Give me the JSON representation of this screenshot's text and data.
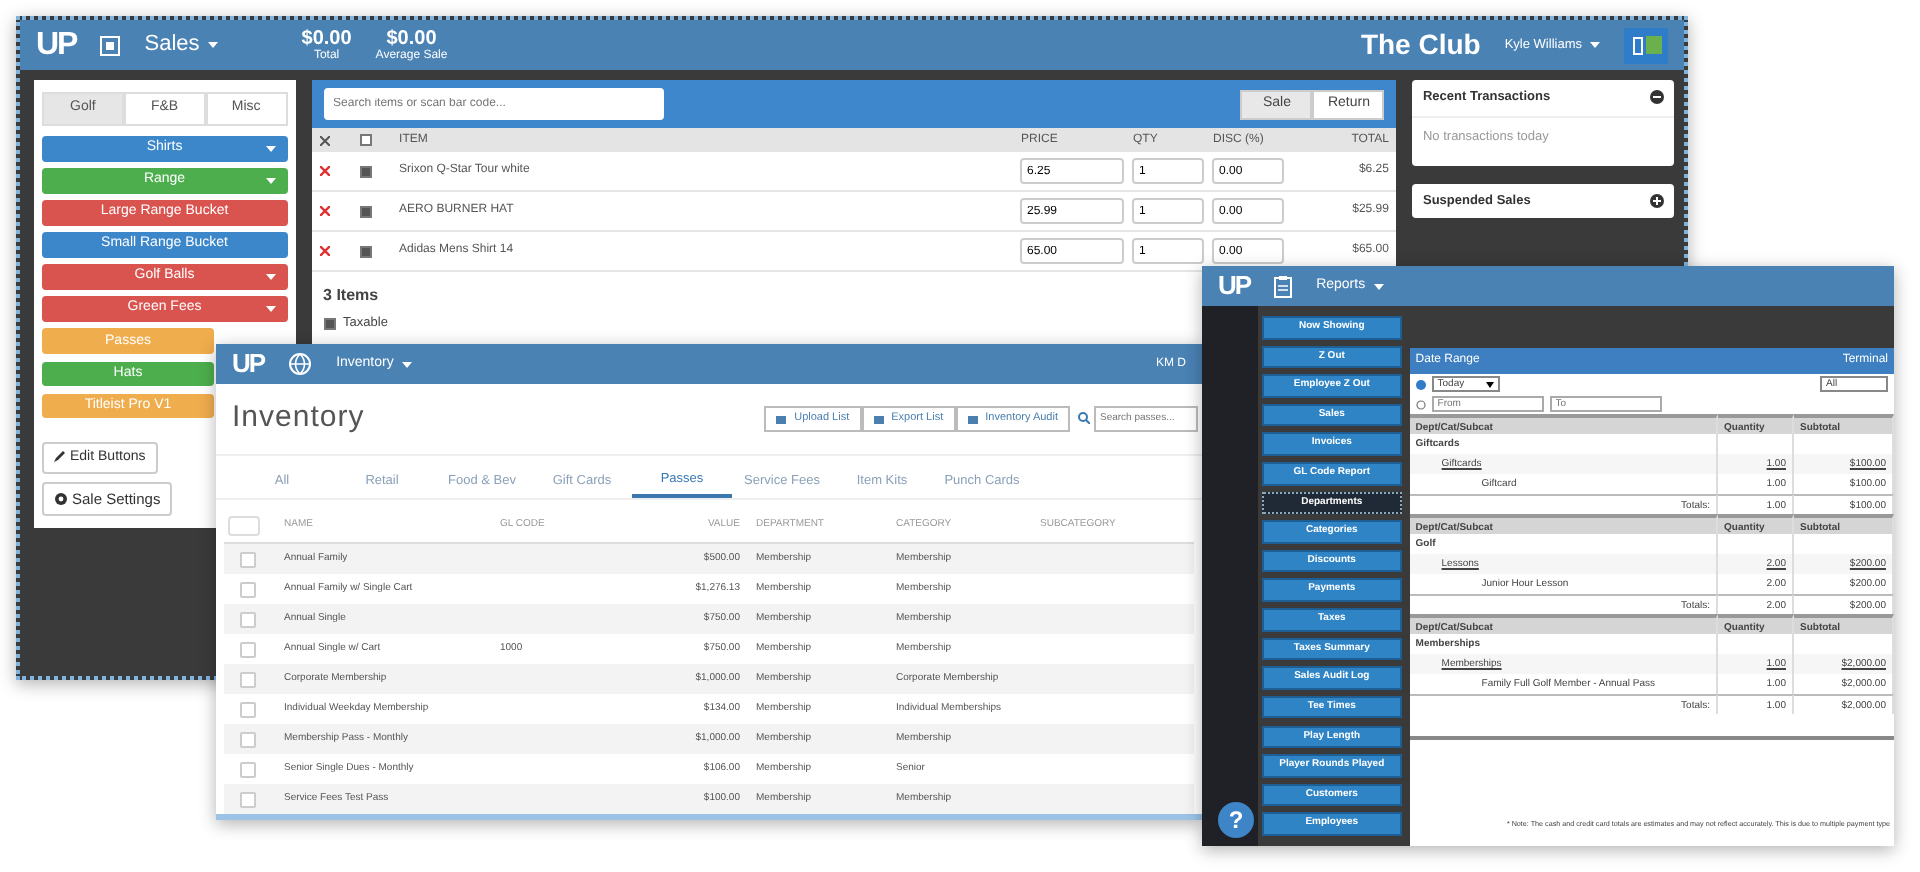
{
  "pos": {
    "logo": "UP",
    "menu": "Sales",
    "stats": [
      {
        "value": "$0.00",
        "label": "Total"
      },
      {
        "value": "$0.00",
        "label": "Average Sale"
      }
    ],
    "club": "The Club",
    "user": "Kyle Williams",
    "category_tabs": [
      {
        "label": "Golf",
        "selected": true
      },
      {
        "label": "F&B",
        "selected": false
      },
      {
        "label": "Misc",
        "selected": false
      }
    ],
    "buttons": [
      {
        "label": "Shirts",
        "color": "#3b87c9",
        "dropdown": true
      },
      {
        "label": "Range",
        "color": "#4cae4c",
        "dropdown": true
      },
      {
        "label": "Large Range Bucket",
        "color": "#d9534f",
        "dropdown": false
      },
      {
        "label": "Small Range Bucket",
        "color": "#3b87c9",
        "dropdown": false
      },
      {
        "label": "Golf Balls",
        "color": "#d9534f",
        "dropdown": true
      },
      {
        "label": "Green Fees",
        "color": "#d9534f",
        "dropdown": true
      },
      {
        "label": "Passes",
        "color": "#f0ad4e",
        "dropdown": false
      },
      {
        "label": "Hats",
        "color": "#4cae4c",
        "dropdown": false
      },
      {
        "label": "Titleist Pro V1",
        "color": "#f0ad4e",
        "dropdown": false
      }
    ],
    "edit_button": "Edit Buttons",
    "settings_button": "Sale Settings",
    "search": {
      "placeholder": "Search items or scan bar code..."
    },
    "mode_toggle": [
      {
        "label": "Sale",
        "selected": true
      },
      {
        "label": "Return",
        "selected": false
      }
    ],
    "cart": {
      "columns": [
        "ITEM",
        "PRICE",
        "QTY",
        "DISC (%)",
        "TOTAL"
      ],
      "rows": [
        {
          "checked": true,
          "item": "Srixon Q-Star Tour white",
          "price": "6.25",
          "qty": "1",
          "disc": "0.00",
          "total": "$6.25"
        },
        {
          "checked": true,
          "item": "AERO BURNER HAT",
          "price": "25.99",
          "qty": "1",
          "disc": "0.00",
          "total": "$25.99"
        },
        {
          "checked": true,
          "item": "Adidas Mens Shirt 14",
          "price": "65.00",
          "qty": "1",
          "disc": "0.00",
          "total": "$65.00"
        }
      ]
    },
    "item_count": "3 Items",
    "taxable": {
      "label": "Taxable",
      "checked": true
    },
    "recent": {
      "title": "Recent Transactions",
      "empty": "No transactions today"
    },
    "suspended": {
      "title": "Suspended Sales"
    }
  },
  "inventory": {
    "logo": "UP",
    "menu": "Inventory",
    "user": "KM D",
    "title": "Inventory",
    "actions": [
      "Upload List",
      "Export List",
      "Inventory Audit"
    ],
    "search": {
      "placeholder": "Search passes..."
    },
    "tabs": [
      {
        "label": "All",
        "selected": false
      },
      {
        "label": "Retail",
        "selected": false
      },
      {
        "label": "Food & Bev",
        "selected": false
      },
      {
        "label": "Gift Cards",
        "selected": false
      },
      {
        "label": "Passes",
        "selected": true
      },
      {
        "label": "Service Fees",
        "selected": false
      },
      {
        "label": "Item Kits",
        "selected": false
      },
      {
        "label": "Punch Cards",
        "selected": false
      }
    ],
    "columns": [
      "NAME",
      "GL CODE",
      "VALUE",
      "DEPARTMENT",
      "CATEGORY",
      "SUBCATEGORY"
    ],
    "rows": [
      {
        "checked": false,
        "name": "Annual Family",
        "value": "$500.00",
        "department": "Membership",
        "category": "Membership"
      },
      {
        "checked": false,
        "name": "Annual Family w/ Single Cart",
        "value": "$1,276.13",
        "department": "Membership",
        "category": "Membership"
      },
      {
        "checked": false,
        "name": "Annual Single",
        "value": "$750.00",
        "department": "Membership",
        "category": "Membership"
      },
      {
        "checked": false,
        "name": "Annual Single w/ Cart",
        "gl_code": "1000",
        "value": "$750.00",
        "department": "Membership",
        "category": "Membership"
      },
      {
        "checked": false,
        "name": "Corporate Membership",
        "value": "$1,000.00",
        "department": "Membership",
        "category": "Corporate Membership"
      },
      {
        "checked": false,
        "name": "Individual Weekday Membership",
        "value": "$134.00",
        "department": "Membership",
        "category": "Individual Memberships"
      },
      {
        "checked": false,
        "name": "Membership Pass - Monthly",
        "value": "$1,000.00",
        "department": "Membership",
        "category": "Membership"
      },
      {
        "checked": false,
        "name": "Senior Single Dues - Monthly",
        "value": "$106.00",
        "department": "Membership",
        "category": "Senior"
      },
      {
        "checked": false,
        "name": "Service Fees Test Pass",
        "value": "$100.00",
        "department": "Membership",
        "category": "Membership"
      }
    ]
  },
  "reports": {
    "logo": "UP",
    "menu": "Reports",
    "nav": [
      {
        "label": "Now Showing",
        "selected": false
      },
      {
        "label": "Z Out",
        "selected": false
      },
      {
        "label": "Employee Z Out",
        "selected": false
      },
      {
        "label": "Sales",
        "selected": false
      },
      {
        "label": "Invoices",
        "selected": false
      },
      {
        "label": "GL Code Report",
        "selected": false
      },
      {
        "label": "Departments",
        "selected": true
      },
      {
        "label": "Categories",
        "selected": false
      },
      {
        "label": "Discounts",
        "selected": false
      },
      {
        "label": "Payments",
        "selected": false
      },
      {
        "label": "Taxes",
        "selected": false
      },
      {
        "label": "Taxes Summary",
        "selected": false
      },
      {
        "label": "Sales Audit Log",
        "selected": false
      },
      {
        "label": "Tee Times",
        "selected": false
      },
      {
        "label": "Play Length",
        "selected": false
      },
      {
        "label": "Player Rounds Played",
        "selected": false
      },
      {
        "label": "Customers",
        "selected": false
      },
      {
        "label": "Employees",
        "selected": false
      }
    ],
    "date_range": {
      "title": "Date Range",
      "terminal_label": "Terminal",
      "period": "Today",
      "terminal": "All",
      "from_placeholder": "From",
      "to_placeholder": "To"
    },
    "sections": [
      {
        "columns": [
          "Dept/Cat/Subcat",
          "Quantity",
          "Subtotal"
        ],
        "name": "Giftcards",
        "group": {
          "name": "Giftcards",
          "quantity": "1.00",
          "subtotal": "$100.00"
        },
        "items": [
          {
            "name": "Giftcard",
            "quantity": "1.00",
            "subtotal": "$100.00"
          }
        ],
        "totals": {
          "label": "Totals:",
          "quantity": "1.00",
          "subtotal": "$100.00"
        }
      },
      {
        "columns": [
          "Dept/Cat/Subcat",
          "Quantity",
          "Subtotal"
        ],
        "name": "Golf",
        "group": {
          "name": "Lessons",
          "quantity": "2.00",
          "subtotal": "$200.00"
        },
        "items": [
          {
            "name": "Junior Hour Lesson",
            "quantity": "2.00",
            "subtotal": "$200.00"
          }
        ],
        "totals": {
          "label": "Totals:",
          "quantity": "2.00",
          "subtotal": "$200.00"
        }
      },
      {
        "columns": [
          "Dept/Cat/Subcat",
          "Quantity",
          "Subtotal"
        ],
        "name": "Memberships",
        "group": {
          "name": "Memberships",
          "quantity": "1.00",
          "subtotal": "$2,000.00"
        },
        "items": [
          {
            "name": "Family Full Golf Member - Annual Pass",
            "quantity": "1.00",
            "subtotal": "$2,000.00"
          }
        ],
        "totals": {
          "label": "Totals:",
          "quantity": "1.00",
          "subtotal": "$2,000.00"
        }
      }
    ],
    "note": "* Note: The cash and credit card totals are estimates and may not reflect accurately. This is due to multiple payment type",
    "help": "?"
  }
}
